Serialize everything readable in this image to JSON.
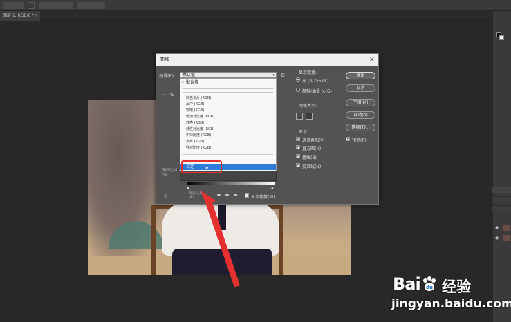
{
  "document": {
    "tab_label": "图层 1, RGB/8 *",
    "tab_close": "×"
  },
  "dialog": {
    "title": "曲线",
    "close": "×",
    "preset_label": "预设(R):",
    "preset_value": "默认值",
    "preset_arrow": "▾",
    "preset_items": {
      "default": "默认值",
      "color_negative": "彩色负片 (RGB)",
      "reverse": "反冲 (RGB)",
      "darker": "较暗 (RGB)",
      "increase_contrast": "增加对比度 (RGB)",
      "lighter": "较亮 (RGB)",
      "linear_contrast": "线性对比度 (RGB)",
      "medium_contrast": "中对比度 (RGB)",
      "negative": "负片 (RGB)",
      "strong_contrast": "强对比度 (RGB)",
      "custom": "自定"
    },
    "output_label": "输出(O):",
    "output_value": "58",
    "input_label": "输入(I):",
    "input_value": "42",
    "show_clipping": "显示修剪(W)",
    "show_amount": "显示数量:",
    "light_option": "光 (0-255)(L)",
    "pigment_option": "颜料/油墨 %(G)",
    "grid_size": "网格大小:",
    "show": "显示:",
    "channel_overlays": "通道叠加(V)",
    "histogram": "直方图(H)",
    "baseline": "基线(B)",
    "intersection_line": "交叉线(N)",
    "preview": "预览(P)",
    "ok": "确定",
    "cancel": "取消",
    "smooth": "平滑(M)",
    "auto": "自动(A)",
    "options": "选项(T)..."
  },
  "icons": {
    "dialog_options": "gear-icon",
    "curve_pencil": "pencil-icon",
    "curve_point": "curve-point-icon",
    "hand_target": "hand-target-icon",
    "black_eyedropper": "eyedropper-black-icon",
    "gray_eyedropper": "eyedropper-gray-icon",
    "white_eyedropper": "eyedropper-white-icon",
    "cursor": "cursor-arrow-icon"
  },
  "watermark": {
    "brand": "Bai",
    "cn": "经验",
    "url": "jingyan.baidu.com"
  },
  "colors": {
    "selection_blue": "#2f7cd8",
    "annotation_red": "#e53030",
    "dialog_bg": "#535353"
  }
}
